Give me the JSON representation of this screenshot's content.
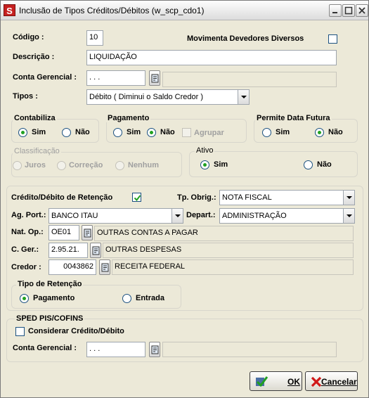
{
  "window": {
    "title": "Inclusão de Tipos Créditos/Débitos (w_scp_cdo1)",
    "app_icon_letter": "S"
  },
  "form": {
    "codigo_label": "Código :",
    "codigo_value": "10",
    "movimenta_label": "Movimenta Devedores Diversos",
    "descricao_label": "Descrição :",
    "descricao_value": "LIQUIDAÇÃO",
    "conta_gerencial_label": "Conta Gerencial :",
    "conta_gerencial_value": ". . .",
    "conta_gerencial_desc": "",
    "tipos_label": "Tipos :",
    "tipos_value": "Débito ( Diminui o Saldo Credor )"
  },
  "contabiliza": {
    "title": "Contabiliza",
    "sim": "Sim",
    "nao": "Não",
    "selected": "Sim"
  },
  "pagamento": {
    "title": "Pagamento",
    "sim": "Sim",
    "nao": "Não",
    "agrupar": "Agrupar",
    "selected": "Não"
  },
  "data_futura": {
    "title": "Permite Data Futura",
    "sim": "Sim",
    "nao": "Não",
    "selected": "Não"
  },
  "classificacao": {
    "title": "Classificação",
    "juros": "Juros",
    "correcao": "Correção",
    "nenhum": "Nenhum"
  },
  "ativo": {
    "title": "Ativo",
    "sim": "Sim",
    "nao": "Não",
    "selected": "Sim"
  },
  "retencao": {
    "credito_debito_label": "Crédito/Débito de Retenção",
    "credito_debito_checked": true,
    "tp_obrig_label": "Tp. Obrig.:",
    "tp_obrig_value": "NOTA FISCAL",
    "ag_port_label": "Ag. Port.:",
    "ag_port_value": "BANCO ITAU",
    "depart_label": "Depart.:",
    "depart_value": "ADMINISTRAÇÃO",
    "nat_op_label": "Nat. Op.:",
    "nat_op_code": "OE01",
    "nat_op_desc": "OUTRAS CONTAS A PAGAR",
    "c_ger_label": "C. Ger.:",
    "c_ger_code": "2.95.21.",
    "c_ger_desc": "OUTRAS DESPESAS",
    "credor_label": "Credor :",
    "credor_code": "0043862",
    "credor_desc": "RECEITA FEDERAL"
  },
  "tipo_retencao": {
    "title": "Tipo de Retenção",
    "pagamento": "Pagamento",
    "entrada": "Entrada",
    "selected": "Pagamento"
  },
  "sped": {
    "title": "SPED PIS/COFINS",
    "considerar_label": "Considerar Crédito/Débito",
    "considerar_checked": false,
    "conta_gerencial_label": "Conta Gerencial :",
    "conta_gerencial_value": ". . .",
    "conta_gerencial_desc": ""
  },
  "buttons": {
    "ok": "OK",
    "cancelar": "Cancelar"
  },
  "colors": {
    "title_icon": "#c62020",
    "radio_dot": "#21a121",
    "check_mark": "#21a121"
  }
}
